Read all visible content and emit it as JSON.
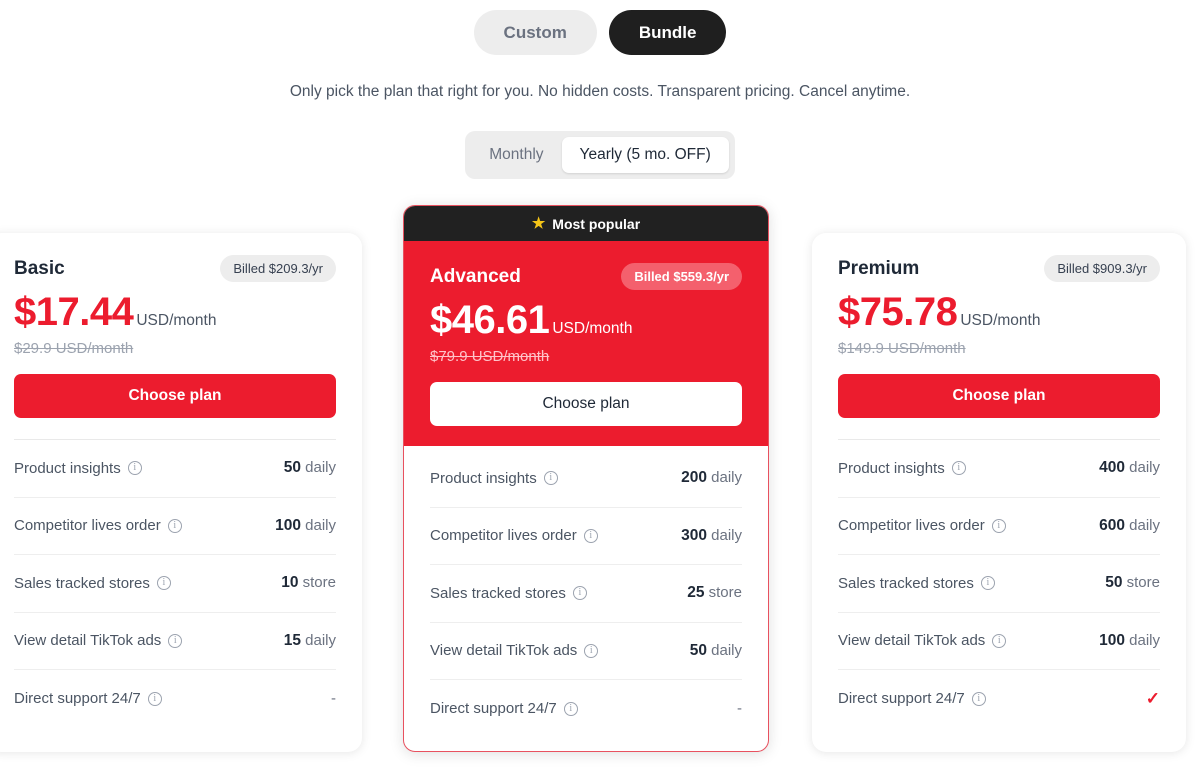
{
  "mode_switch": {
    "options": [
      {
        "label": "Custom",
        "active": false
      },
      {
        "label": "Bundle",
        "active": true
      }
    ]
  },
  "subtitle": "Only pick the plan that right for you. No hidden costs. Transparent pricing. Cancel anytime.",
  "cycle_switch": {
    "options": [
      {
        "label": "Monthly",
        "active": false
      },
      {
        "label": "Yearly (5 mo. OFF)",
        "active": true
      }
    ]
  },
  "colors": {
    "accent_red": "#ec1c2e",
    "popular_bar": "#212121",
    "star": "#f5c518",
    "muted_text": "#6b7280"
  },
  "plans": {
    "basic": {
      "name": "Basic",
      "billed": "Billed $209.3/yr",
      "price": "$17.44",
      "price_unit": "USD/month",
      "old_price": "$29.9 USD/month",
      "cta": "Choose plan",
      "features": [
        {
          "label": "Product insights",
          "value": "50",
          "unit": "daily",
          "icon": "info-icon"
        },
        {
          "label": "Competitor lives order",
          "value": "100",
          "unit": "daily",
          "icon": "info-icon"
        },
        {
          "label": "Sales tracked stores",
          "value": "10",
          "unit": "store",
          "icon": "info-icon"
        },
        {
          "label": "View detail TikTok ads",
          "value": "15",
          "unit": "daily",
          "icon": "info-icon"
        },
        {
          "label": "Direct support 24/7",
          "value": "-",
          "unit": "",
          "icon": "info-icon"
        }
      ]
    },
    "advanced": {
      "badge": "Most popular",
      "name": "Advanced",
      "billed": "Billed $559.3/yr",
      "price": "$46.61",
      "price_unit": "USD/month",
      "old_price": "$79.9 USD/month",
      "cta": "Choose plan",
      "features": [
        {
          "label": "Product insights",
          "value": "200",
          "unit": "daily",
          "icon": "info-icon"
        },
        {
          "label": "Competitor lives order",
          "value": "300",
          "unit": "daily",
          "icon": "info-icon"
        },
        {
          "label": "Sales tracked stores",
          "value": "25",
          "unit": "store",
          "icon": "info-icon"
        },
        {
          "label": "View detail TikTok ads",
          "value": "50",
          "unit": "daily",
          "icon": "info-icon"
        },
        {
          "label": "Direct support 24/7",
          "value": "-",
          "unit": "",
          "icon": "info-icon"
        }
      ]
    },
    "premium": {
      "name": "Premium",
      "billed": "Billed $909.3/yr",
      "price": "$75.78",
      "price_unit": "USD/month",
      "old_price": "$149.9 USD/month",
      "cta": "Choose plan",
      "features": [
        {
          "label": "Product insights",
          "value": "400",
          "unit": "daily",
          "icon": "info-icon"
        },
        {
          "label": "Competitor lives order",
          "value": "600",
          "unit": "daily",
          "icon": "info-icon"
        },
        {
          "label": "Sales tracked stores",
          "value": "50",
          "unit": "store",
          "icon": "info-icon"
        },
        {
          "label": "View detail TikTok ads",
          "value": "100",
          "unit": "daily",
          "icon": "info-icon"
        },
        {
          "label": "Direct support 24/7",
          "value": "✓",
          "unit": "",
          "icon": "info-icon",
          "is_check": true
        }
      ]
    }
  }
}
